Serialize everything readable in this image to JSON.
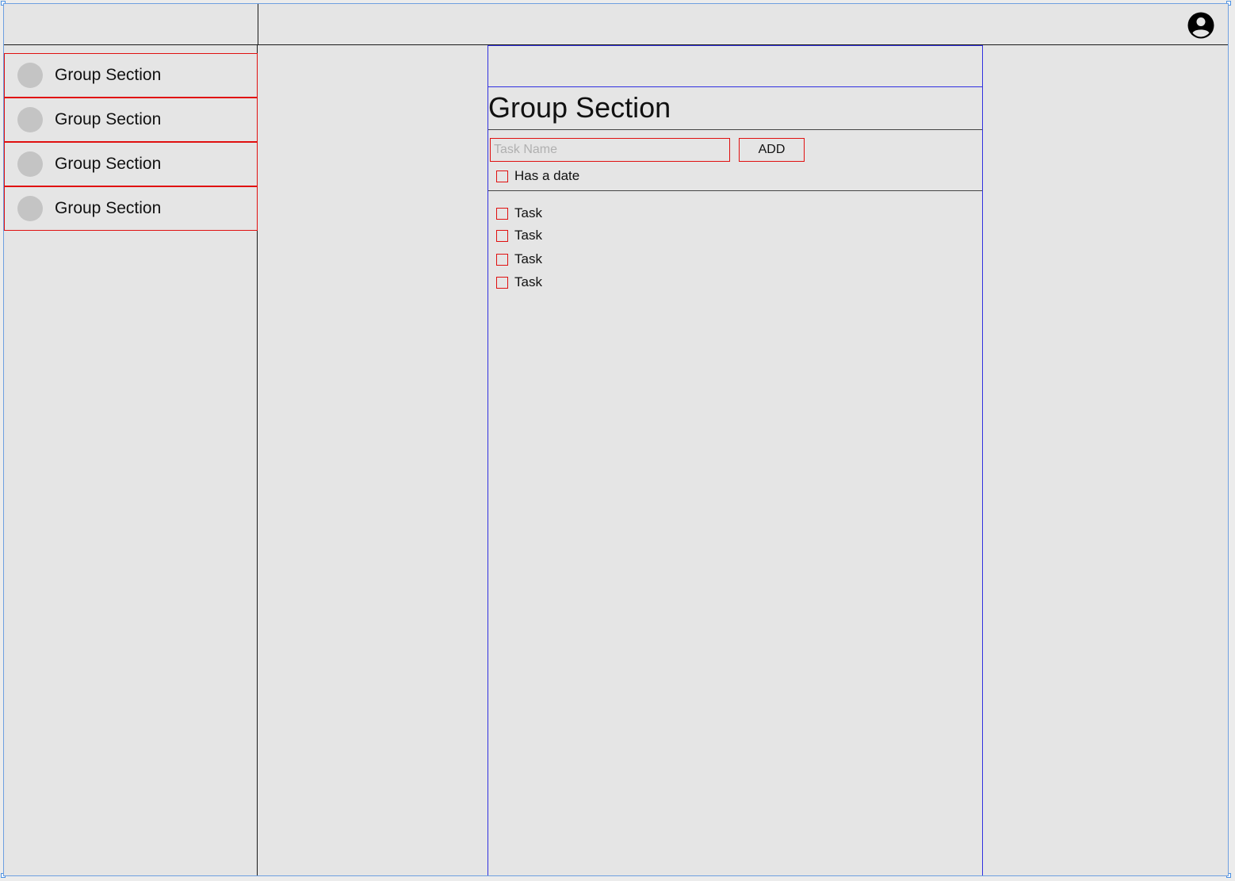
{
  "header": {
    "account_icon": "account-circle-icon"
  },
  "sidebar": {
    "items": [
      {
        "label": "Group Section",
        "icon": "group-avatar-icon"
      },
      {
        "label": "Group Section",
        "icon": "group-avatar-icon"
      },
      {
        "label": "Group Section",
        "icon": "group-avatar-icon"
      },
      {
        "label": "Group Section",
        "icon": "group-avatar-icon"
      }
    ]
  },
  "main": {
    "title": "Group Section",
    "task_input": {
      "placeholder": "Task Name",
      "value": ""
    },
    "add_label": "ADD",
    "has_date_label": "Has a date",
    "tasks": [
      {
        "label": "Task",
        "checked": false
      },
      {
        "label": "Task",
        "checked": false
      },
      {
        "label": "Task",
        "checked": false
      },
      {
        "label": "Task",
        "checked": false
      }
    ]
  },
  "colors": {
    "background": "#e5e5e5",
    "accent_red": "#e01010",
    "accent_blue": "#3030e0",
    "avatar_gray": "#c4c4c4"
  }
}
